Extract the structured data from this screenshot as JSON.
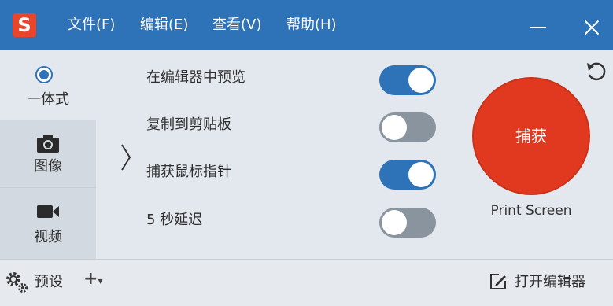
{
  "titlebar": {
    "logo_letter": "S",
    "menus": [
      "文件(F)",
      "编辑(E)",
      "查看(V)",
      "帮助(H)"
    ]
  },
  "sidebar": {
    "items": [
      {
        "label": "一体式",
        "icon": "radio-selected"
      },
      {
        "label": "图像",
        "icon": "camera-icon"
      },
      {
        "label": "视频",
        "icon": "video-camera-icon"
      }
    ]
  },
  "options": [
    {
      "label": "在编辑器中预览",
      "state": "on"
    },
    {
      "label": "复制到剪贴板",
      "state": "off"
    },
    {
      "label": "捕获鼠标指针",
      "state": "on"
    },
    {
      "label": "5 秒延迟",
      "state": "off"
    }
  ],
  "capture": {
    "label": "捕获",
    "shortcut": "Print Screen"
  },
  "footer": {
    "preset_label": "预设",
    "add_label": "+",
    "open_editor_label": "打开编辑器"
  },
  "colors": {
    "titlebar": "#2e72b8",
    "accent": "#2e72b8",
    "capture": "#e0391f",
    "toggle_off": "#8a949f"
  }
}
